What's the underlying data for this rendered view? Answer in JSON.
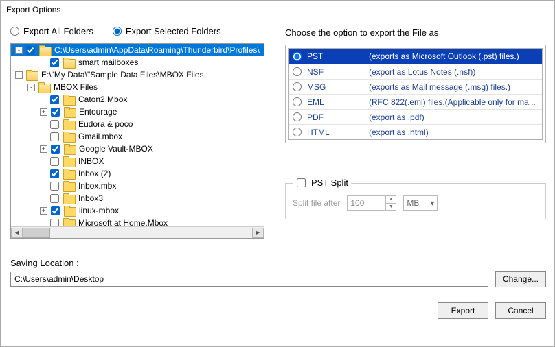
{
  "window": {
    "title": "Export Options"
  },
  "scope": {
    "all": "Export All Folders",
    "selected": "Export Selected Folders"
  },
  "tree": [
    {
      "indent": 0,
      "expander": "-",
      "checked": true,
      "label": "C:\\Users\\admin\\AppData\\Roaming\\Thunderbird\\Profiles\\",
      "selected": true,
      "open": true
    },
    {
      "indent": 2,
      "expander": "",
      "checked": true,
      "label": "smart mailboxes",
      "open": true
    },
    {
      "indent": 0,
      "expander": "-",
      "checked": false,
      "noCheckbox": true,
      "label": "E:\\\"My Data\\\"Sample Data Files\\MBOX Files",
      "open": true
    },
    {
      "indent": 1,
      "expander": "-",
      "checked": false,
      "noCheckbox": true,
      "label": "MBOX Files",
      "open": true
    },
    {
      "indent": 2,
      "expander": "",
      "checked": true,
      "label": "Caton2.Mbox"
    },
    {
      "indent": 2,
      "expander": "+",
      "checked": true,
      "label": "Entourage"
    },
    {
      "indent": 2,
      "expander": "",
      "checked": false,
      "label": "Eudora & poco"
    },
    {
      "indent": 2,
      "expander": "",
      "checked": false,
      "label": "Gmail.mbox"
    },
    {
      "indent": 2,
      "expander": "+",
      "checked": true,
      "label": "Google Vault-MBOX"
    },
    {
      "indent": 2,
      "expander": "",
      "checked": false,
      "label": "INBOX"
    },
    {
      "indent": 2,
      "expander": "",
      "checked": true,
      "label": "Inbox (2)"
    },
    {
      "indent": 2,
      "expander": "",
      "checked": false,
      "label": "Inbox.mbx"
    },
    {
      "indent": 2,
      "expander": "",
      "checked": false,
      "label": "Inbox3"
    },
    {
      "indent": 2,
      "expander": "+",
      "checked": true,
      "label": "linux-mbox"
    },
    {
      "indent": 2,
      "expander": "",
      "checked": false,
      "label": "Microsoft at Home.Mbox"
    }
  ],
  "formats": {
    "heading": "Choose the option to export the File as",
    "items": [
      {
        "name": "PST",
        "desc": "(exports as Microsoft Outlook (.pst) files.)",
        "selected": true
      },
      {
        "name": "NSF",
        "desc": "(export as Lotus Notes (.nsf))"
      },
      {
        "name": "MSG",
        "desc": "(exports as Mail message (.msg) files.)"
      },
      {
        "name": "EML",
        "desc": "(RFC 822(.eml) files.(Applicable only for ma..."
      },
      {
        "name": "PDF",
        "desc": "(export as .pdf)"
      },
      {
        "name": "HTML",
        "desc": "(export as .html)"
      }
    ]
  },
  "split": {
    "title": "PST Split",
    "label": "Split file after",
    "value": "100",
    "unit": "MB"
  },
  "save": {
    "label": "Saving Location :",
    "path": "C:\\Users\\admin\\Desktop"
  },
  "buttons": {
    "change": "Change...",
    "export": "Export",
    "cancel": "Cancel"
  }
}
